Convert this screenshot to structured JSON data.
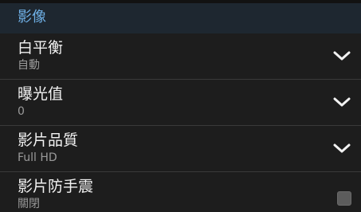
{
  "section": {
    "title": "影像"
  },
  "settings": [
    {
      "title": "白平衡",
      "value": "自動",
      "control": "dropdown",
      "icon": "chevron-down-icon"
    },
    {
      "title": "曝光值",
      "value": "0",
      "control": "dropdown",
      "icon": "chevron-down-icon"
    },
    {
      "title": "影片品質",
      "value": "Full HD",
      "control": "dropdown",
      "icon": "chevron-down-icon"
    },
    {
      "title": "影片防手震",
      "value": "關閉",
      "control": "checkbox",
      "checked": false
    }
  ],
  "colors": {
    "background": "#1b1b1b",
    "header_bg": "#1e2730",
    "header_text": "#6fb0e6",
    "title_text": "#f2f2f2",
    "value_text": "#9a9a9a"
  }
}
